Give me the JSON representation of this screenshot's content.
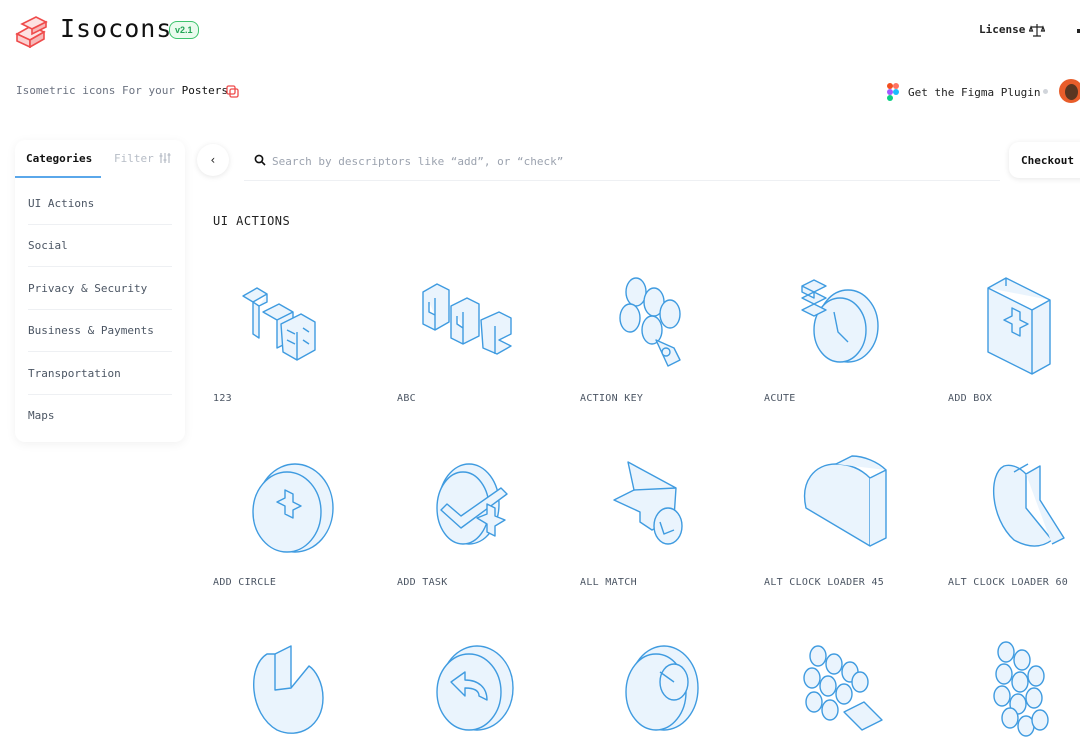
{
  "header": {
    "brand": "Isocons",
    "version": "v2.1",
    "license_label": "License",
    "tagline_prefix": "Isometric icons For your",
    "tagline_link": "Posters",
    "figma_label": "Get the Figma Plugin"
  },
  "sidebar": {
    "tab_categories": "Categories",
    "tab_filter": "Filter",
    "items": [
      {
        "label": "UI Actions"
      },
      {
        "label": "Social"
      },
      {
        "label": "Privacy & Security"
      },
      {
        "label": "Business & Payments"
      },
      {
        "label": "Transportation"
      },
      {
        "label": "Maps"
      }
    ]
  },
  "toolbar": {
    "back_icon": "chevron-left-icon",
    "search_placeholder": "Search by descriptors like “add”, or “check”",
    "search_value": "",
    "checkout_label": "Checkout"
  },
  "section": {
    "title": "UI ACTIONS"
  },
  "icons": [
    {
      "label": "123",
      "icon": "numbers-123-icon"
    },
    {
      "label": "ABC",
      "icon": "letters-abc-icon"
    },
    {
      "label": "ACTION KEY",
      "icon": "action-key-icon"
    },
    {
      "label": "ACUTE",
      "icon": "acute-clock-icon"
    },
    {
      "label": "ADD BOX",
      "icon": "add-box-icon"
    },
    {
      "label": "ADD CIRCLE",
      "icon": "add-circle-icon"
    },
    {
      "label": "ADD TASK",
      "icon": "add-task-icon"
    },
    {
      "label": "ALL MATCH",
      "icon": "all-match-icon"
    },
    {
      "label": "ALT CLOCK LOADER 45",
      "icon": "clock-loader-45-icon"
    },
    {
      "label": "ALT CLOCK LOADER 60",
      "icon": "clock-loader-60-icon"
    },
    {
      "label": "",
      "icon": "clock-loader-icon"
    },
    {
      "label": "",
      "icon": "restore-icon"
    },
    {
      "label": "",
      "icon": "ring-icon"
    },
    {
      "label": "",
      "icon": "cylinders-icon"
    },
    {
      "label": "",
      "icon": "cylinders-grid-icon"
    }
  ],
  "colors": {
    "accent": "#5aa7ea",
    "icon_stroke": "#3f9be0",
    "icon_fill": "#eaf4fd",
    "logo": "#ef4b4b",
    "version_green": "#3ec46d"
  }
}
